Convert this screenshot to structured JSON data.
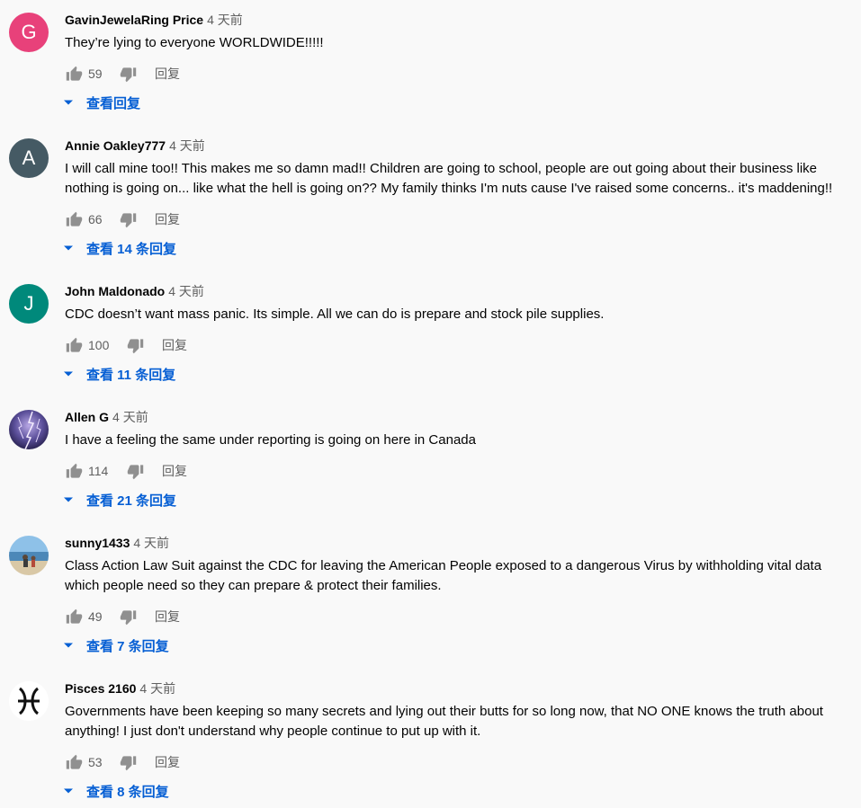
{
  "comments": [
    {
      "author": "GavinJewelaRing Price",
      "time": "4 天前",
      "text": "They’re lying to everyone WORLDWIDE!!!!!",
      "likes": "59",
      "reply_label": "回复",
      "view_replies": "查看回复",
      "avatar_letter": "G",
      "avatar_color": "#e8417a"
    },
    {
      "author": "Annie Oakley777",
      "time": "4 天前",
      "text": "I will call mine too!!  This makes me so damn mad!! Children are going to school, people are out going about their business like nothing is going on... like what the hell is going on?? My family thinks I'm nuts cause I've raised some concerns.. it's maddening!!",
      "likes": "66",
      "reply_label": "回复",
      "view_replies": "查看 14 条回复",
      "avatar_letter": "A",
      "avatar_color": "#455a64"
    },
    {
      "author": "John Maldonado",
      "time": "4 天前",
      "text": "CDC doesn’t want mass panic. Its simple. All we can do is prepare and stock pile supplies.",
      "likes": "100",
      "reply_label": "回复",
      "view_replies": "查看 11 条回复",
      "avatar_letter": "J",
      "avatar_color": "#00897b"
    },
    {
      "author": "Allen G",
      "time": "4 天前",
      "text": "I have a feeling the same under reporting is going on here in Canada",
      "likes": "114",
      "reply_label": "回复",
      "view_replies": "查看 21 条回复",
      "avatar_letter": "",
      "avatar_color": "#3b3a6e"
    },
    {
      "author": "sunny1433",
      "time": "4 天前",
      "text": "Class Action Law Suit against the CDC for leaving the American People exposed to a dangerous Virus by withholding vital data which people need so they can prepare & protect their families.",
      "likes": "49",
      "reply_label": "回复",
      "view_replies": "查看 7 条回复",
      "avatar_letter": "",
      "avatar_color": "#7fb2d9"
    },
    {
      "author": "Pisces 2160",
      "time": "4 天前",
      "text": "Governments have been keeping so many secrets and lying out their butts for so long now, that NO ONE knows the truth about anything! I just don't understand why people continue to put up with it.",
      "likes": "53",
      "reply_label": "回复",
      "view_replies": "查看 8 条回复",
      "avatar_letter": "",
      "avatar_color": "#ffffff"
    }
  ],
  "colors": {
    "link_blue": "#065fd4",
    "secondary_text": "#606060",
    "background": "#f9f9f9"
  },
  "icons": {
    "like": "thumb-up-icon",
    "dislike": "thumb-down-icon",
    "expand": "caret-down-icon"
  }
}
